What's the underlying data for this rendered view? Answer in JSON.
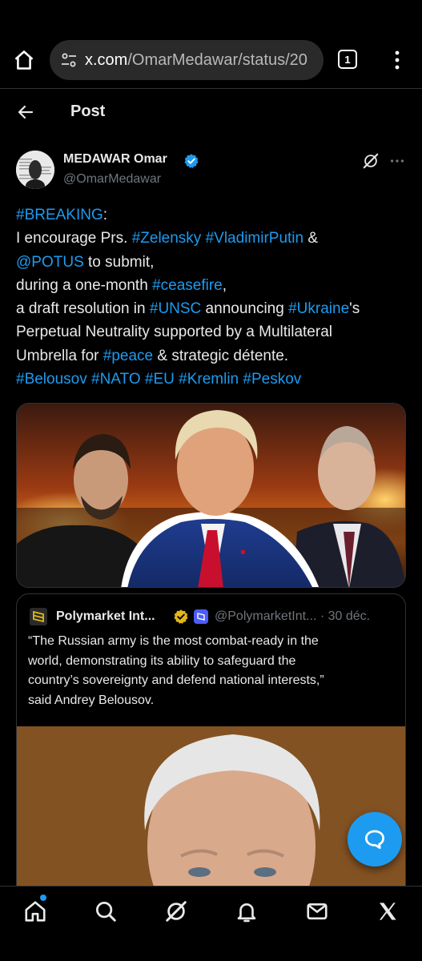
{
  "browser": {
    "url_host": "x.com",
    "url_path": "/OmarMedawar/status/20",
    "tab_count": "1"
  },
  "header": {
    "title": "Post"
  },
  "author": {
    "name": "MEDAWAR Omar",
    "handle": "@OmarMedawar"
  },
  "tweet": {
    "lines": [
      [
        {
          "t": "#BREAKING",
          "tag": true
        },
        {
          "t": ":"
        }
      ],
      [
        {
          "t": "I encourage Prs. "
        },
        {
          "t": "#Zelensky",
          "tag": true
        },
        {
          "t": " "
        },
        {
          "t": "#VladimirPutin",
          "tag": true
        },
        {
          "t": " &"
        }
      ],
      [
        {
          "t": "@POTUS",
          "tag": true
        },
        {
          "t": " to submit,"
        }
      ],
      [
        {
          "t": "during a one-month "
        },
        {
          "t": "#ceasefire",
          "tag": true
        },
        {
          "t": ","
        }
      ],
      [
        {
          "t": "a draft resolution in "
        },
        {
          "t": "#UNSC",
          "tag": true
        },
        {
          "t": " announcing "
        },
        {
          "t": "#Ukraine",
          "tag": true
        },
        {
          "t": "'s"
        }
      ],
      [
        {
          "t": "Perpetual Neutrality supported by a Multilateral"
        }
      ],
      [
        {
          "t": "Umbrella for "
        },
        {
          "t": "#peace",
          "tag": true
        },
        {
          "t": " & strategic détente."
        }
      ],
      [
        {
          "t": "#Belousov",
          "tag": true
        },
        {
          "t": " "
        },
        {
          "t": "#NATO",
          "tag": true
        },
        {
          "t": " "
        },
        {
          "t": "#EU",
          "tag": true
        },
        {
          "t": " "
        },
        {
          "t": "#Kremlin",
          "tag": true
        },
        {
          "t": " "
        },
        {
          "t": "#Peskov",
          "tag": true
        }
      ]
    ]
  },
  "quote": {
    "name": "Polymarket Int...",
    "handle_date": "@PolymarketInt... · 30 déc.",
    "lines": [
      "“The Russian army is the most combat-ready in the",
      "world, demonstrating its ability to safeguard the",
      "country’s sovereignty and defend national interests,”",
      "said Andrey Belousov."
    ]
  },
  "icons": {
    "browser": [
      "home-icon",
      "tune-icon",
      "tabs-icon",
      "menu-icon"
    ],
    "nav": [
      "home-icon",
      "search-icon",
      "grok-icon",
      "notifications-icon",
      "messages-icon",
      "x-logo-icon"
    ],
    "fab": "compose-reply-icon"
  },
  "colors": {
    "accent": "#1d9bf0",
    "background": "#000000",
    "text": "#e7e9ea",
    "muted": "#71767b",
    "url_pill": "#2a2a2a",
    "gold_badge": "#e2b719"
  }
}
